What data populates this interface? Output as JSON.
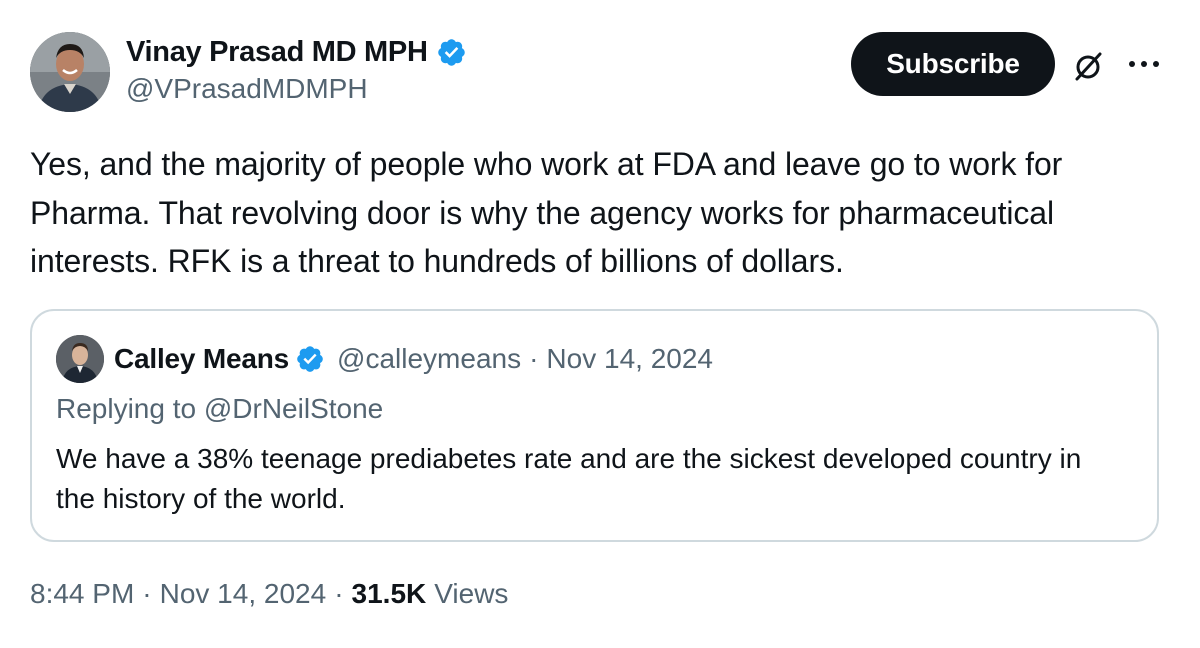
{
  "author": {
    "name": "Vinay Prasad MD MPH",
    "handle": "@VPrasadMDMPH",
    "verified": true,
    "avatar": "avatar-man-smiling"
  },
  "actions": {
    "subscribe_label": "Subscribe",
    "grok_icon": "grok-slashed-circle-icon",
    "more_icon": "more-horizontal-icon"
  },
  "tweet": {
    "text": "Yes, and the majority of people who work at FDA and leave go to work for Pharma. That revolving door is why the agency works for pharmaceutical interests. RFK is a threat to hundreds of billions of dollars."
  },
  "quote": {
    "name": "Calley Means",
    "handle": "@calleymeans",
    "separator": "·",
    "date": "Nov 14, 2024",
    "verified": true,
    "replying_to": "Replying to @DrNeilStone",
    "text": "We have a 38% teenage prediabetes rate and are the sickest developed country in the history of the world."
  },
  "footer": {
    "time": "8:44 PM",
    "separator": "·",
    "date": "Nov 14, 2024",
    "views_count": "31.5K",
    "views_label": "Views"
  },
  "colors": {
    "verified_blue": "#1d9bf0",
    "text_primary": "#0f1419",
    "text_secondary": "#536471",
    "border": "#cfd9de",
    "button_bg": "#0f1419"
  }
}
